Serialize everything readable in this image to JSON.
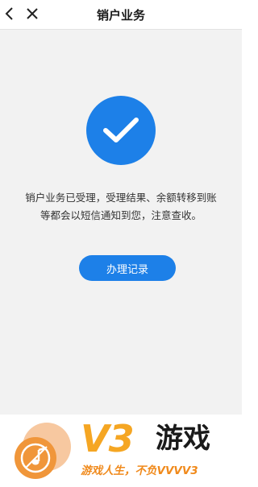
{
  "header": {
    "title": "销户业务",
    "back_icon": "chevron-left-icon",
    "close_icon": "close-icon"
  },
  "result": {
    "status_icon": "checkmark-icon",
    "message_line1": "销户业务已受理，受理结果、余额转移到账",
    "message_line2": "等都会以短信通知到您，注意查收。",
    "button_label": "办理记录"
  },
  "banner": {
    "logo_icon": "music-note-icon",
    "brand_mark": "V3",
    "brand_name": "游戏",
    "slogan": "游戏人生，不负VVVV3"
  },
  "colors": {
    "accent": "#1d80e8",
    "brand_orange": "#f5a623",
    "background": "#f2f2f2"
  }
}
